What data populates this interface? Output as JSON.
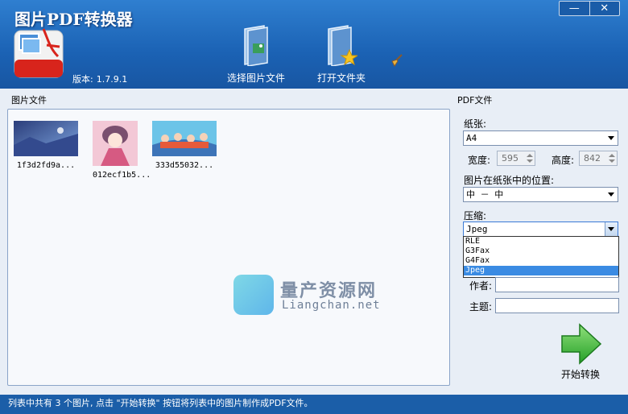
{
  "app": {
    "title": "图片PDF转换器",
    "version_label": "版本:",
    "version_value": "1.7.9.1"
  },
  "window_controls": {
    "minimize": "—",
    "close": "✕"
  },
  "toolbar": {
    "select_images_label": "选择图片文件",
    "open_folder_label": "打开文件夹",
    "clear_icon": "broom-icon"
  },
  "files": {
    "group_label": "图片文件",
    "items": [
      {
        "name": "1f3d2fd9a..."
      },
      {
        "name": "012ecf1b5..."
      },
      {
        "name": "333d55032..."
      }
    ]
  },
  "watermark": {
    "title": "量产资源网",
    "subtitle": "Liangchan.net"
  },
  "pdf": {
    "group_label": "PDF文件",
    "paper_label": "纸张:",
    "paper_value": "A4",
    "width_label": "宽度:",
    "width_value": "595",
    "height_label": "高度:",
    "height_value": "842",
    "position_label": "图片在纸张中的位置:",
    "position_value": "中 － 中",
    "compress_label": "压缩:",
    "compress_value": "Jpeg",
    "compress_options": [
      "RLE",
      "G3Fax",
      "G4Fax",
      "Jpeg"
    ],
    "author_label": "作者:",
    "author_value": "",
    "subject_label": "主题:",
    "subject_value": "",
    "start_label": "开始转换"
  },
  "status": {
    "text": "列表中共有 3 个图片, 点击 \"开始转换\" 按钮将列表中的图片制作成PDF文件。"
  },
  "colors": {
    "header_blue": "#1b62b4",
    "panel_bg": "#e8eef6",
    "selection_blue": "#3a8be3",
    "go_green": "#3cb43c"
  }
}
